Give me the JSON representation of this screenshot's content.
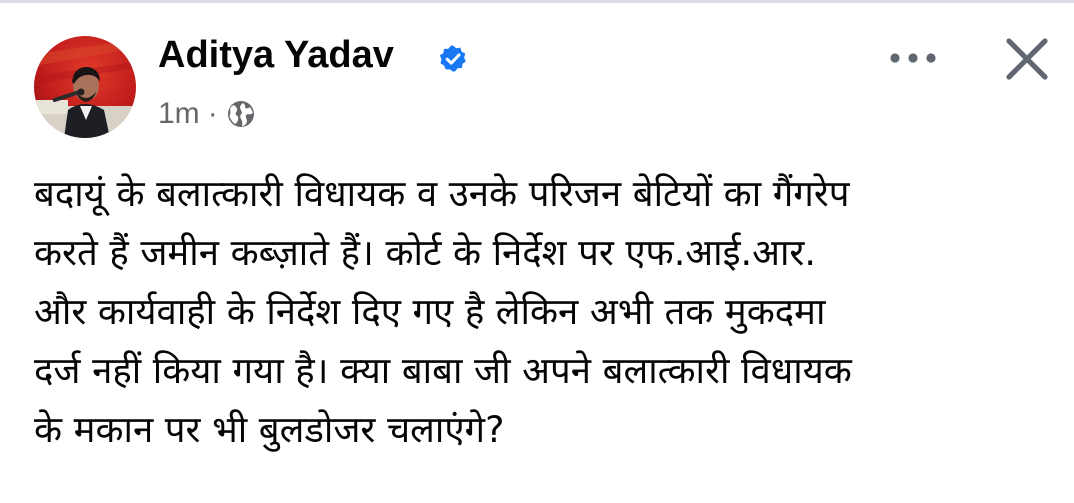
{
  "post": {
    "author": {
      "name": "Aditya Yadav",
      "verified": true,
      "avatar_icon": "profile-photo"
    },
    "meta": {
      "timestamp": "1m",
      "separator": "·",
      "audience_icon": "globe-icon"
    },
    "actions": {
      "more_icon": "more-horizontal-icon",
      "close_icon": "close-icon"
    },
    "text_lines": [
      "बदायूं के बलात्कारी विधायक  व उनके परिजन बेटियों का गैंगरेप",
      "करते हैं जमीन कब्ज़ाते हैं। कोर्ट के निर्देश पर एफ.आई.आर.",
      "और कार्यवाही के निर्देश दिए गए है लेकिन अभी तक मुकदमा",
      "दर्ज नहीं किया गया है। क्या बाबा जी अपने बलात्कारी विधायक",
      "के मकान पर भी बुलडोजर चलाएंगे?"
    ]
  },
  "colors": {
    "text_primary": "#050505",
    "text_secondary": "#65676b",
    "verified_blue": "#1877f2",
    "avatar_bg_red": "#c8201e"
  }
}
